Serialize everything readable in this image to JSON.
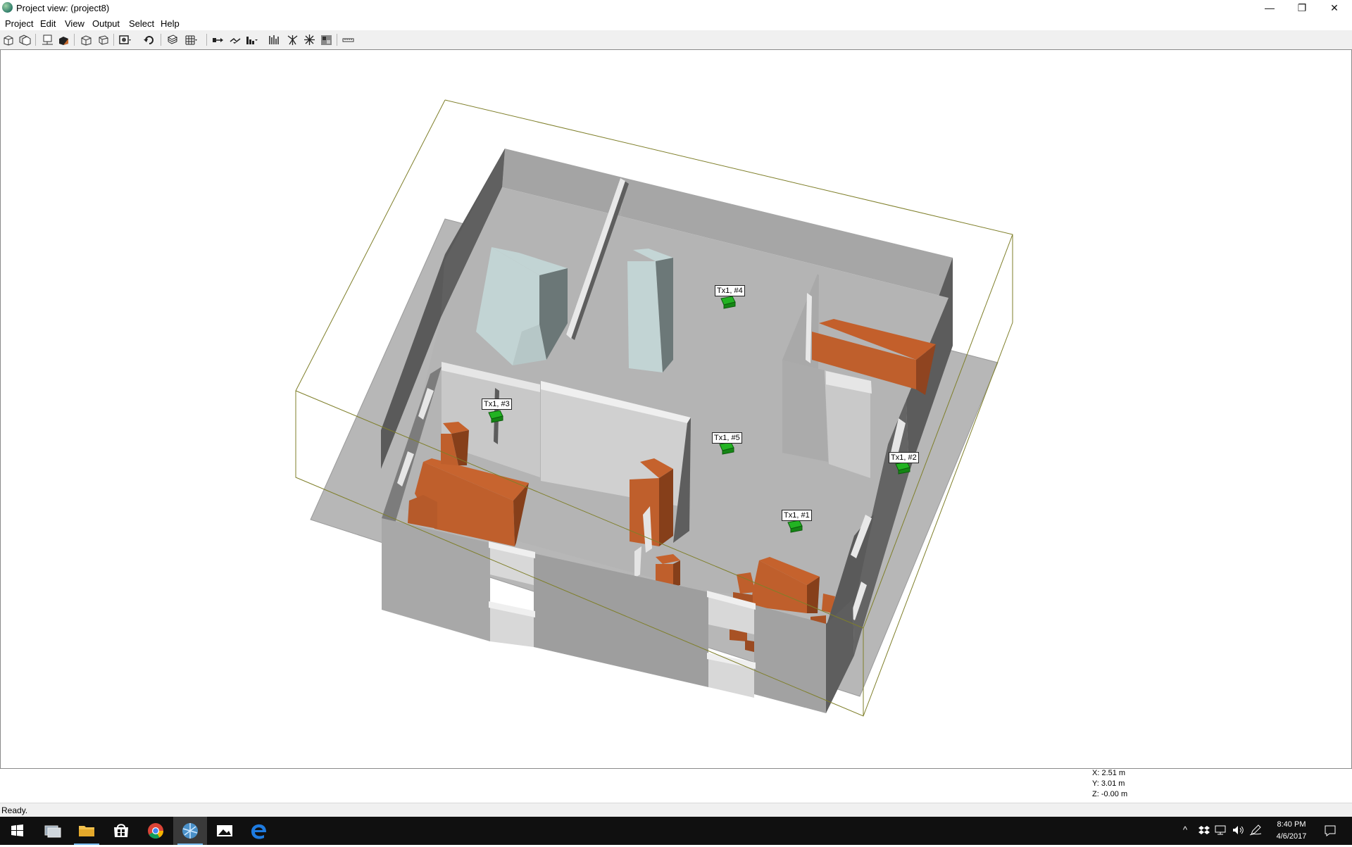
{
  "window": {
    "title": "Project view: (project8)",
    "controls": {
      "minimize": "—",
      "restore": "❐",
      "close": "✕"
    }
  },
  "menu": [
    "Project",
    "Edit",
    "View",
    "Output",
    "Select",
    "Help"
  ],
  "toolbar": {
    "icons": [
      "new-project-icon",
      "open-project-icon",
      "save-view-icon",
      "solid-view-icon",
      "wireframe-icon",
      "perspective-icon",
      "camera-icon",
      "rotate-icon",
      "layers-icon",
      "grid-icon",
      "transmitter-arrow-icon",
      "route-icon",
      "bar-chart-icon",
      "signal-icon",
      "antenna-icon",
      "starburst-icon",
      "terrain-icon",
      "ruler-icon"
    ]
  },
  "scene": {
    "transmitters": [
      {
        "label": "Tx1, #4"
      },
      {
        "label": "Tx1, #3"
      },
      {
        "label": "Tx1, #5"
      },
      {
        "label": "Tx1, #2"
      },
      {
        "label": "Tx1, #1"
      }
    ],
    "colors": {
      "floor": "#b4b4b4",
      "wall_light": "#d6d6d6",
      "wall_mid": "#a4a4a4",
      "wall_dark": "#5e5e5e",
      "furniture": "#bf5f2c",
      "appliance": "#c2d4d4",
      "transmitter": "#22b322",
      "bounding_box": "#7f7f2a"
    }
  },
  "coordinates": {
    "x": "X: 2.51 m",
    "y": "Y: 3.01 m",
    "z": "Z: -0.00 m"
  },
  "status": "Ready.",
  "taskbar": {
    "apps": [
      "start-icon",
      "task-view-icon",
      "file-explorer-icon",
      "store-icon",
      "chrome-icon",
      "wireless-insite-icon",
      "photos-icon",
      "edge-icon"
    ],
    "clock_time": "8:40 PM",
    "clock_date": "4/6/2017"
  }
}
